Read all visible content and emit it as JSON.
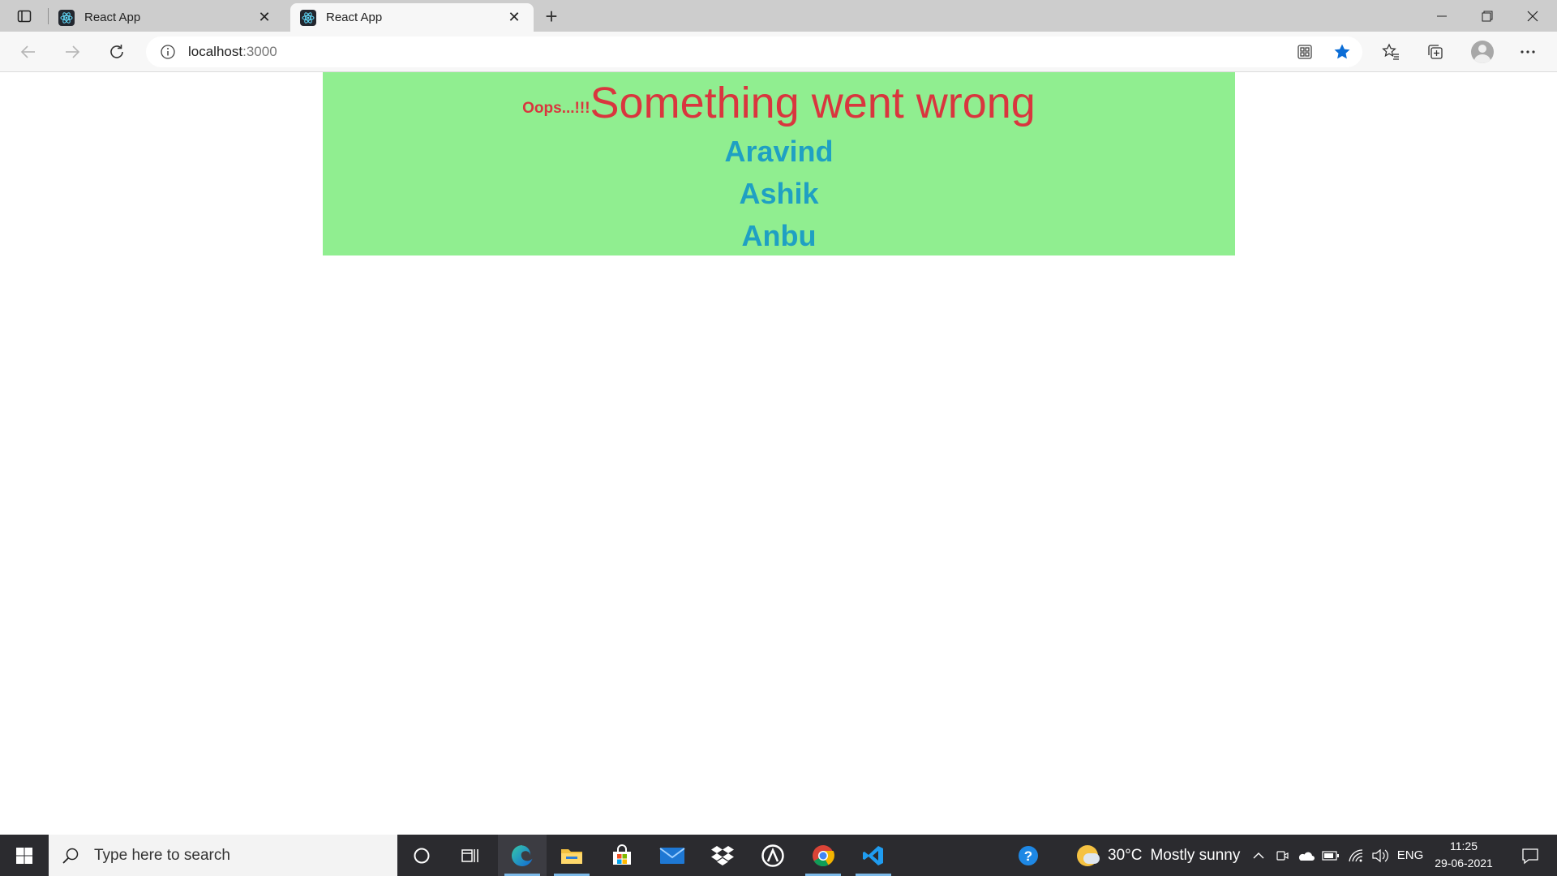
{
  "browser": {
    "tabs": [
      {
        "title": "React App",
        "active": false
      },
      {
        "title": "React App",
        "active": true
      }
    ],
    "address": {
      "host": "localhost",
      "port": ":3000"
    }
  },
  "page": {
    "error_prefix": "Oops...!!!",
    "error_message": "Something went wrong",
    "names": [
      "Aravind",
      "Ashik",
      "Anbu"
    ],
    "colors": {
      "box_background": "#90ee90",
      "error_text": "#d9363e",
      "name_text": "#1fa0c3"
    }
  },
  "taskbar": {
    "search_placeholder": "Type here to search",
    "weather": {
      "temp": "30°C",
      "condition": "Mostly sunny"
    },
    "language": "ENG",
    "time": "11:25",
    "date": "29-06-2021"
  }
}
